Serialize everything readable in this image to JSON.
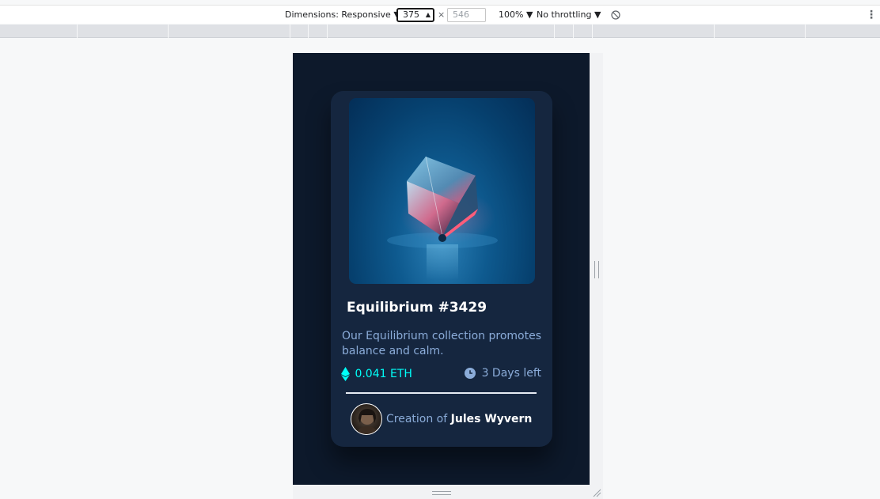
{
  "devtools": {
    "dimensions_label": "Dimensions: Responsive",
    "width_value": "375",
    "times": "×",
    "height_placeholder": "546",
    "zoom": "100%",
    "throttling": "No throttling",
    "icons": {
      "caret": "caret-down-icon",
      "spin": "spin-arrows-icon",
      "rotate": "rotate-icon",
      "more": "more-vertical-icon"
    }
  },
  "card": {
    "title": "Equilibrium #3429",
    "description": "Our Equilibrium collection promotes balance and calm.",
    "price": "0.041 ETH",
    "time_left": "3 Days left",
    "creator_prefix": "Creation of",
    "creator_name": "Jules Wyvern",
    "image_icon": "crystal-cube-image",
    "price_icon": "ethereum-icon",
    "time_icon": "clock-icon"
  },
  "colors": {
    "page_bg": "#0d192b",
    "card_bg": "#15263f",
    "cyan": "#00fff8",
    "soft_blue": "#8bacd9",
    "white": "#ffffff"
  }
}
